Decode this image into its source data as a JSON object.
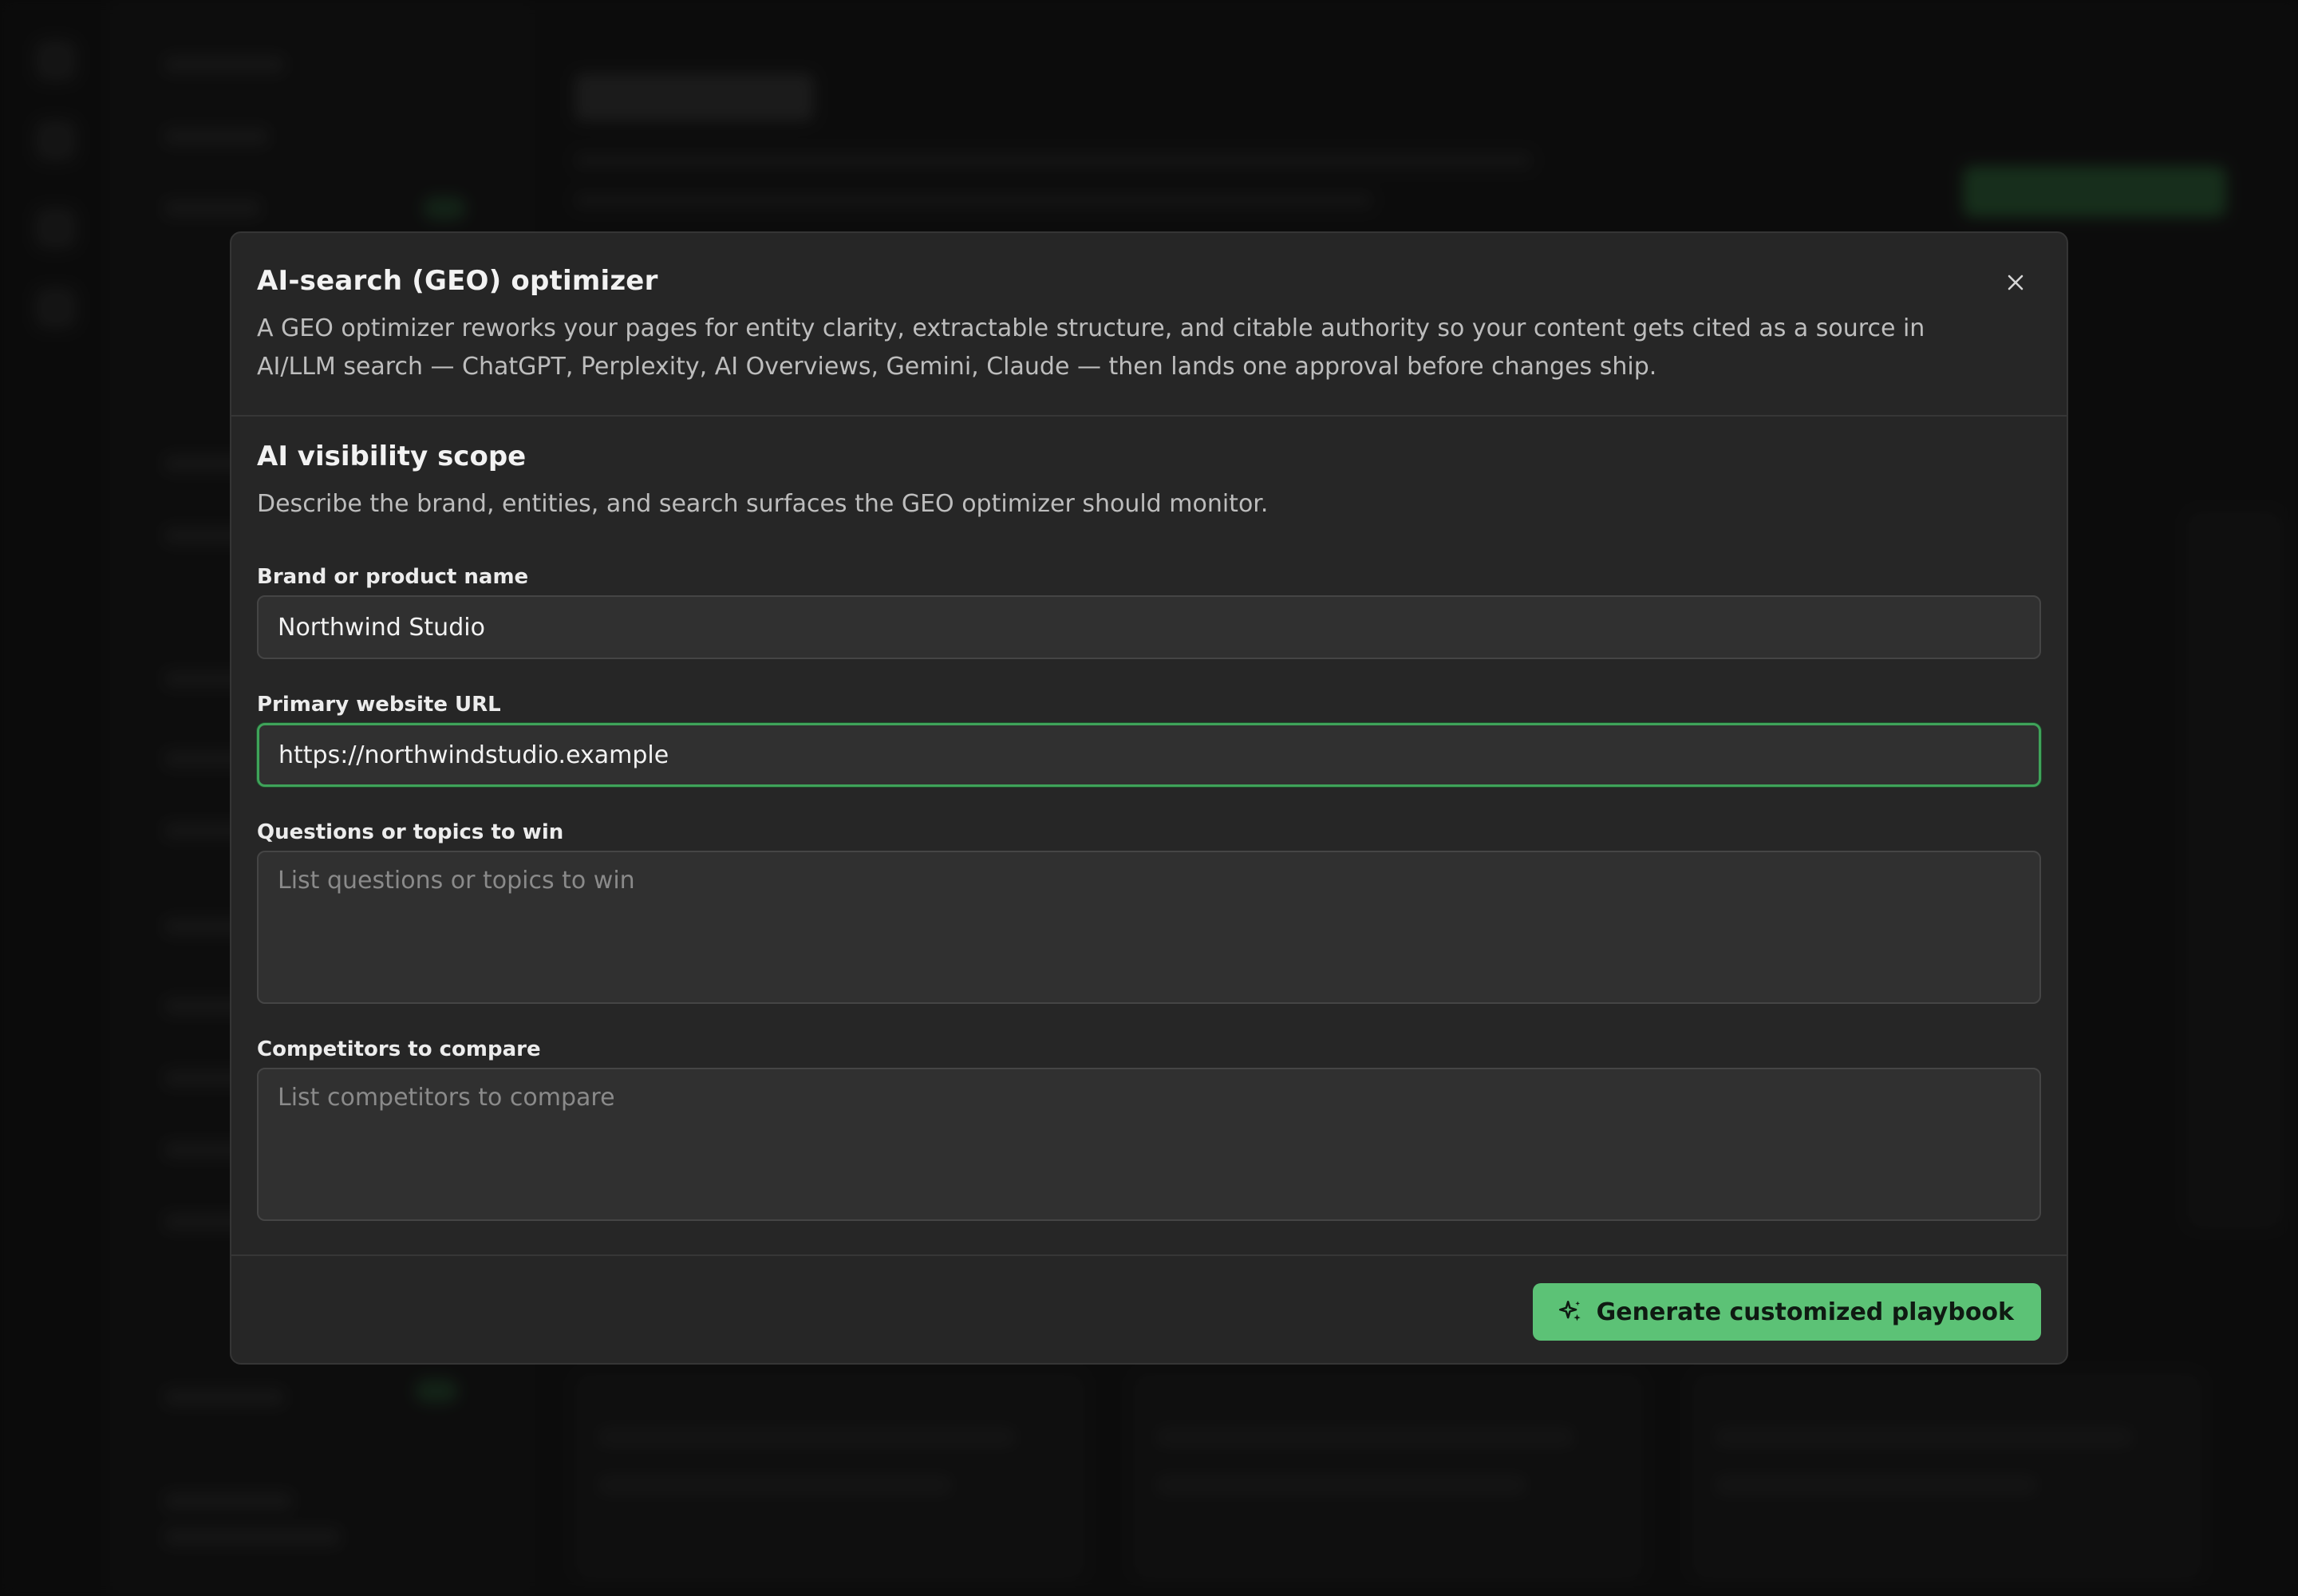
{
  "modal": {
    "title": "AI-search (GEO) optimizer",
    "description": "A GEO optimizer reworks your pages for entity clarity, extractable structure, and citable authority so your content gets cited as a source in AI/LLM search — ChatGPT, Perplexity, AI Overviews, Gemini, Claude — then lands one approval before changes ship.",
    "close_icon": "close-icon"
  },
  "section": {
    "title": "AI visibility scope",
    "description": "Describe the brand, entities, and search surfaces the GEO optimizer should monitor."
  },
  "fields": {
    "brand": {
      "label": "Brand or product name",
      "value": "Northwind Studio"
    },
    "url": {
      "label": "Primary website URL",
      "value": "https://northwindstudio.example"
    },
    "questions": {
      "label": "Questions or topics to win",
      "placeholder": "List questions or topics to win",
      "value": ""
    },
    "competitors": {
      "label": "Competitors to compare",
      "placeholder": "List competitors to compare",
      "value": ""
    }
  },
  "footer": {
    "generate_label": "Generate customized playbook",
    "generate_icon": "sparkles-icon"
  },
  "colors": {
    "accent": "#5cc276",
    "focus_border": "#3fa35a",
    "modal_bg": "#262626",
    "backdrop": "#0f0f0f"
  }
}
